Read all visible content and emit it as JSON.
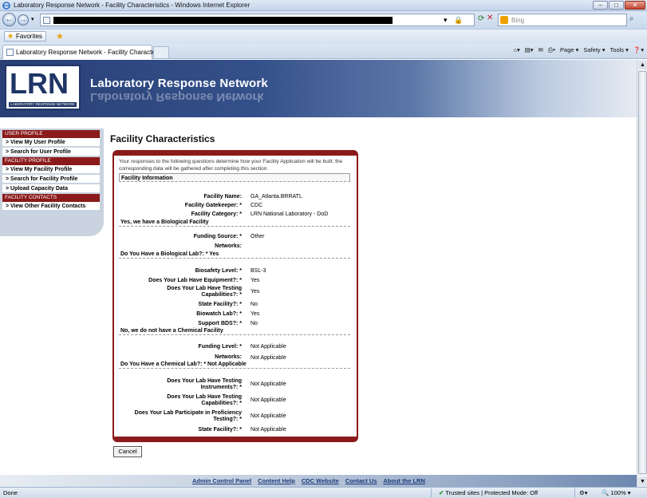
{
  "window": {
    "title": "Laboratory Response Network - Facility Characteristics - Windows Internet Explorer",
    "min_glyph": "–",
    "max_glyph": "□",
    "close_glyph": "✕"
  },
  "browser": {
    "search_placeholder": "Bing",
    "favorites_label": "Favorites",
    "tab_title": "Laboratory Response Network - Facility Character...",
    "commands": [
      "Page ▾",
      "Safety ▾",
      "Tools ▾",
      "❓▾"
    ]
  },
  "banner": {
    "logo_text": "LRN",
    "logo_subtext": "LABORATORY RESPONSE NETWORK",
    "title": "Laboratory Response Network"
  },
  "sidebar": {
    "user_profile_header": "USER PROFILE",
    "user_items": [
      "> View My User Profile",
      "> Search for User Profile"
    ],
    "facility_profile_header": "FACILITY PROFILE",
    "facility_items": [
      "> View My Facility Profile",
      "> Search for Facility Profile",
      "> Upload Capacity Data"
    ],
    "facility_contacts_header": "FACILITY CONTACTS",
    "contact_items": [
      "> View Other Facility Contacts"
    ]
  },
  "main": {
    "page_title": "Facility Characteristics",
    "intro": "Your responses to the following questions determine how your Facility Application will be built; the corresponding data will be gathered after completing this section.",
    "section_facility_info": "Facility Information",
    "facility_name_label": "Facility Name:",
    "facility_name_value": "GA_Atlanta.BRRATL",
    "gatekeeper_label": "Facility Gatekeeper: *",
    "gatekeeper_value": "CDC",
    "category_label": "Facility Category: *",
    "category_value": "LRN National Laboratory - DoD",
    "section_bio": "Yes, we have a Biological Facility",
    "bio_funding_label": "Funding Source: *",
    "bio_funding_value": "Other",
    "bio_networks_label": "Networks:",
    "section_bio_lab": "Do You Have a Biological Lab?: * Yes",
    "biosafety_label": "Biosafety Level: *",
    "biosafety_value": "BSL-3",
    "equipment_label": "Does Your Lab Have Equipment?: *",
    "equipment_value": "Yes",
    "testing_cap_label_1": "Does Your Lab Have Testing",
    "testing_cap_label_2": "Capabilities?: *",
    "testing_cap_value": "Yes",
    "state_facility_label": "State Facility?: *",
    "state_facility_value": "No",
    "biowatch_label": "Biowatch Lab?: *",
    "biowatch_value": "Yes",
    "bds_label": "Support BDS?: *",
    "bds_value": "No",
    "section_chem": "No, we do not have a Chemical Facility",
    "chem_funding_label": "Funding Level: *",
    "chem_funding_value": "Not Applicable",
    "chem_networks_label": "Networks:",
    "chem_networks_value": "Not Applicable",
    "section_chem_lab": "Do You Have a Chemical Lab?: * Not Applicable",
    "instruments_label_1": "Does Your Lab Have Testing",
    "instruments_label_2": "Instruments?: *",
    "instruments_value": "Not Applicable",
    "chem_testing_label_1": "Does Your Lab Have Testing",
    "chem_testing_label_2": "Capabilities?: *",
    "chem_testing_value": "Not Applicable",
    "proficiency_label_1": "Does Your Lab Participate in Proficiency",
    "proficiency_label_2": "Testing?: *",
    "proficiency_value": "Not Applicable",
    "chem_state_label": "State Facility?: *",
    "chem_state_value": "Not Applicable",
    "cancel_label": "Cancel"
  },
  "footer": {
    "links": [
      "Admin Control Panel",
      "Content Help",
      "CDC Website",
      "Contact Us",
      "About the LRN"
    ]
  },
  "status": {
    "left": "Done",
    "zone": "Trusted sites | Protected Mode: Off",
    "zoom": "100%"
  }
}
